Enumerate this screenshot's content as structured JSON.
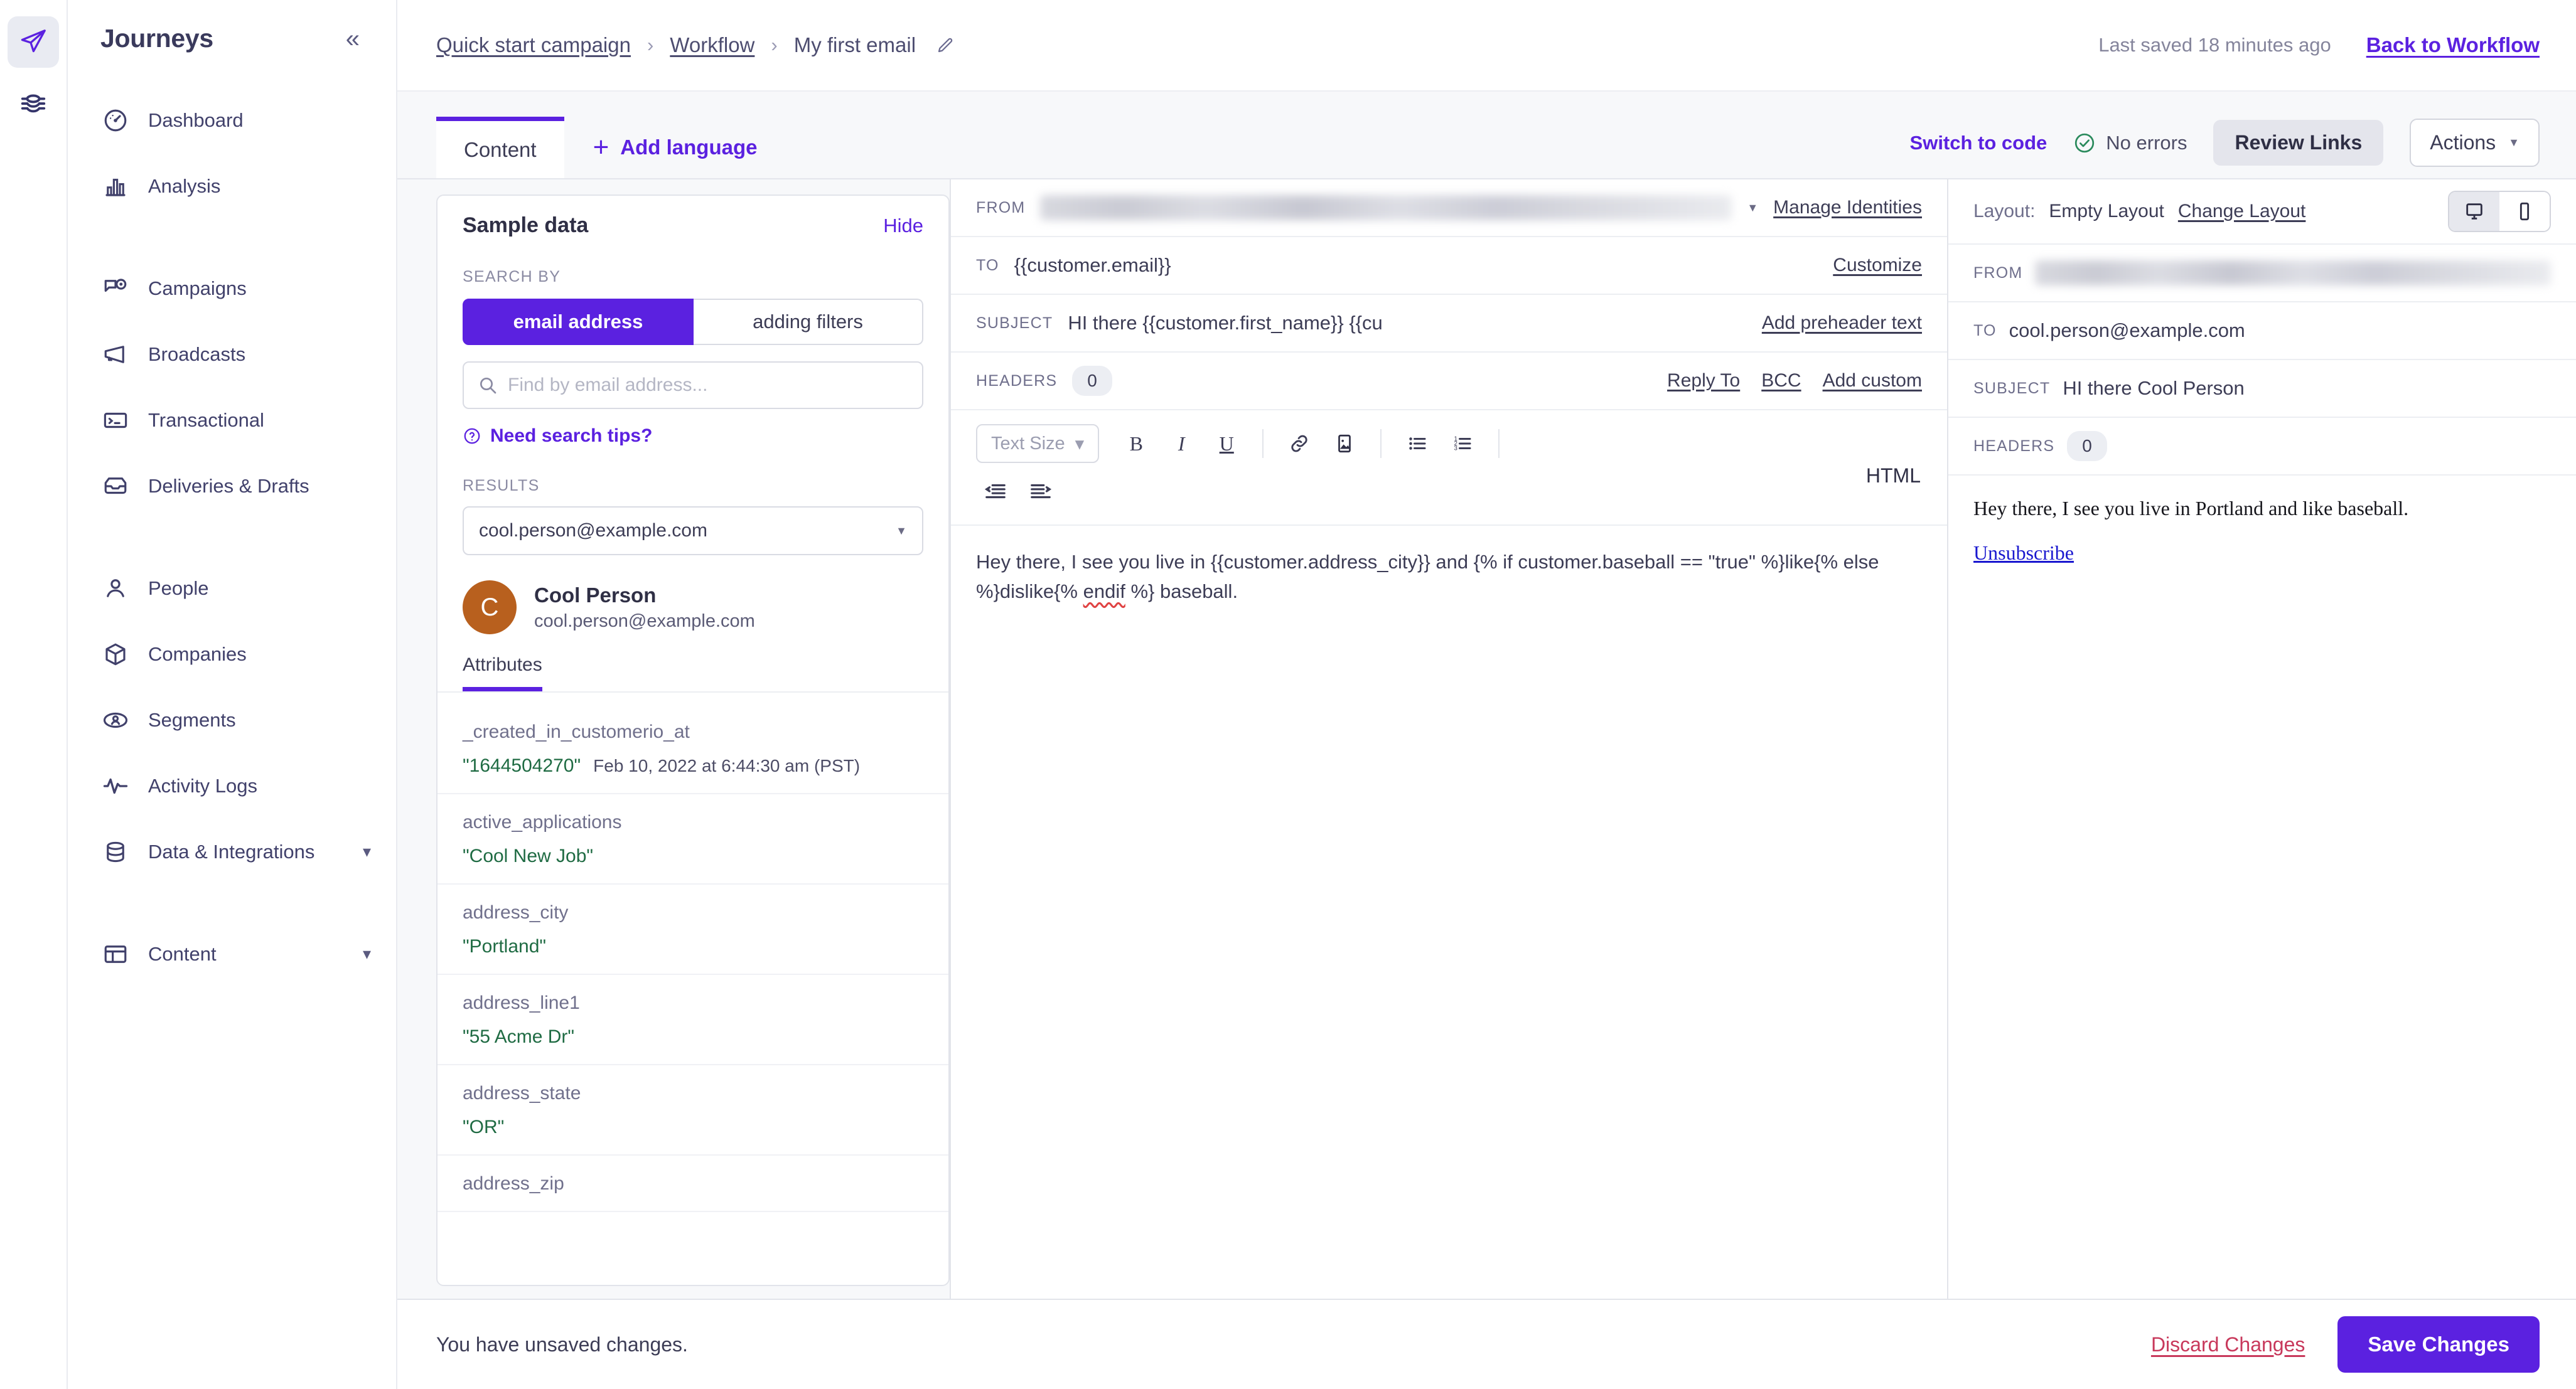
{
  "brand": {
    "accent": "#5b21e0",
    "danger": "#c8385b",
    "success": "#2a8a5c",
    "value_green": "#1f6b43",
    "avatar_bg": "#b8601e"
  },
  "rail": {
    "items": [
      {
        "name": "journeys-rail-icon",
        "icon": "paper-plane-icon",
        "active": true
      },
      {
        "name": "data-rail-icon",
        "icon": "layers-icon",
        "active": false
      }
    ]
  },
  "sidebar": {
    "title": "Journeys",
    "collapse_icon": "chevron-double-left-icon",
    "groups": [
      {
        "items": [
          {
            "label": "Dashboard",
            "icon": "gauge-icon"
          },
          {
            "label": "Analysis",
            "icon": "bar-chart-icon"
          }
        ]
      },
      {
        "items": [
          {
            "label": "Campaigns",
            "icon": "campaign-icon"
          },
          {
            "label": "Broadcasts",
            "icon": "megaphone-icon"
          },
          {
            "label": "Transactional",
            "icon": "terminal-icon"
          },
          {
            "label": "Deliveries & Drafts",
            "icon": "inbox-icon"
          }
        ]
      },
      {
        "items": [
          {
            "label": "People",
            "icon": "person-icon"
          },
          {
            "label": "Companies",
            "icon": "box-icon"
          },
          {
            "label": "Segments",
            "icon": "segment-icon"
          },
          {
            "label": "Activity Logs",
            "icon": "pulse-icon"
          },
          {
            "label": "Data & Integrations",
            "icon": "database-icon",
            "chevron": "chevron-down-icon"
          }
        ]
      },
      {
        "items": [
          {
            "label": "Content",
            "icon": "layout-icon",
            "chevron": "chevron-down-icon"
          }
        ]
      }
    ]
  },
  "topbar": {
    "breadcrumbs": [
      {
        "label": "Quick start campaign",
        "link": true
      },
      {
        "label": "Workflow",
        "link": true
      },
      {
        "label": "My first email",
        "link": false
      }
    ],
    "separator": "›",
    "edit_icon": "pencil-icon",
    "last_saved": "Last saved 18 minutes ago",
    "back_link": "Back to Workflow"
  },
  "toolbar": {
    "tab_label": "Content",
    "add_language": "Add language",
    "switch_to_code": "Switch to code",
    "errors_status": "No errors",
    "errors_icon": "check-circle-icon",
    "review_links": "Review Links",
    "actions": "Actions",
    "actions_caret": "caret-down-icon"
  },
  "sample_data": {
    "title": "Sample data",
    "hide_label": "Hide",
    "search_by_label": "SEARCH BY",
    "seg_email": "email address",
    "seg_filters": "adding filters",
    "search_placeholder": "Find by email address...",
    "search_value": "",
    "search_icon": "search-icon",
    "tips_label": "Need search tips?",
    "tips_icon": "question-circle-icon",
    "results_label": "RESULTS",
    "selected_result": "cool.person@example.com",
    "select_caret": "caret-down-icon",
    "person": {
      "initial": "C",
      "name": "Cool Person",
      "email": "cool.person@example.com"
    },
    "attributes_tab": "Attributes",
    "attributes": [
      {
        "key": "_created_in_customerio_at",
        "value": "\"1644504270\"",
        "note": "Feb 10, 2022 at 6:44:30 am (PST)"
      },
      {
        "key": "active_applications",
        "value": "\"Cool New Job\"",
        "note": ""
      },
      {
        "key": "address_city",
        "value": "\"Portland\"",
        "note": ""
      },
      {
        "key": "address_line1",
        "value": "\"55 Acme Dr\"",
        "note": ""
      },
      {
        "key": "address_state",
        "value": "\"OR\"",
        "note": ""
      },
      {
        "key": "address_zip",
        "value": "",
        "note": ""
      }
    ]
  },
  "editor": {
    "from_label": "FROM",
    "from_value": "",
    "from_caret": "chevron-down-icon",
    "manage_identities": "Manage Identities",
    "to_label": "TO",
    "to_value": "{{customer.email}}",
    "customize": "Customize",
    "subject_label": "SUBJECT",
    "subject_value": "HI there {{customer.first_name}} {{cu",
    "add_preheader": "Add preheader text",
    "headers_label": "HEADERS",
    "headers_count": "0",
    "reply_to": "Reply To",
    "bcc": "BCC",
    "add_custom": "Add custom",
    "text_size": "Text Size",
    "text_size_caret": "chevron-down-icon",
    "html_label": "HTML",
    "tools": [
      {
        "name": "bold-icon",
        "glyph": "B"
      },
      {
        "name": "italic-icon",
        "glyph": "I"
      },
      {
        "name": "underline-icon",
        "glyph": "U"
      },
      {
        "name": "link-icon",
        "glyph": "⚭"
      },
      {
        "name": "image-icon",
        "glyph": "ὛC"
      },
      {
        "name": "bullet-list-icon",
        "glyph": "•"
      },
      {
        "name": "numbered-list-icon",
        "glyph": "1."
      },
      {
        "name": "outdent-icon",
        "glyph": "⬅"
      },
      {
        "name": "indent-icon",
        "glyph": "➡"
      }
    ],
    "body_part1": "Hey there, I see you live in {{customer.address_city}} and {% if customer.baseball == \"true\" %}like{% else %}dislike{% ",
    "body_squiggle": "endif",
    "body_part2": " %} baseball."
  },
  "preview": {
    "layout_label": "Layout:",
    "layout_value": "Empty Layout",
    "change_layout": "Change Layout",
    "desktop_icon": "desktop-icon",
    "mobile_icon": "mobile-icon",
    "from_label": "FROM",
    "from_value": "",
    "to_label": "TO",
    "to_value": "cool.person@example.com",
    "subject_label": "SUBJECT",
    "subject_value": "HI there Cool Person",
    "headers_label": "HEADERS",
    "headers_count": "0",
    "body": "Hey there, I see you live in Portland and like baseball.",
    "unsubscribe": "Unsubscribe"
  },
  "bottombar": {
    "unsaved_text": "You have unsaved changes.",
    "discard": "Discard Changes",
    "save": "Save Changes"
  }
}
